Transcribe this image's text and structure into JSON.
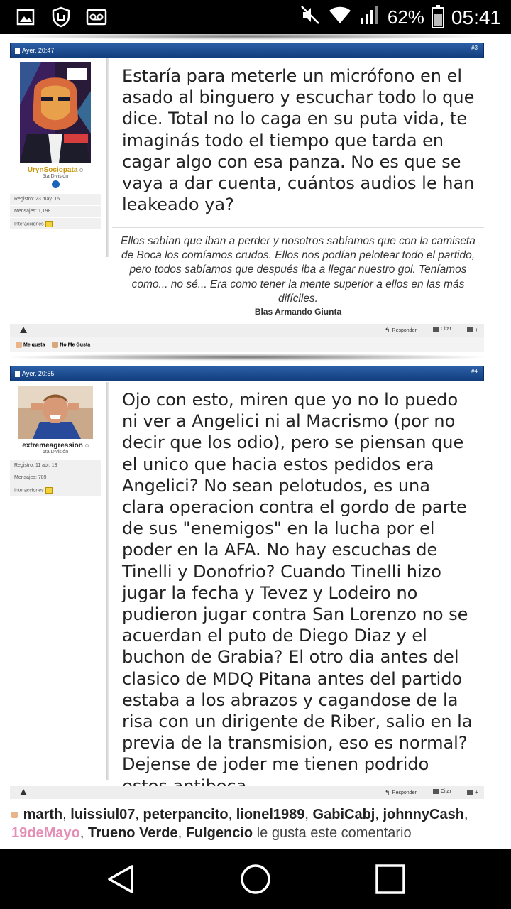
{
  "status_bar": {
    "battery": "62%",
    "time": "05:41",
    "icons": [
      "image-icon",
      "shield-hand-icon",
      "voicemail-icon",
      "mute-icon",
      "wifi-icon",
      "signal-icon",
      "battery-icon"
    ]
  },
  "posts": [
    {
      "date": "Ayer, 20:47",
      "number": "#3",
      "user": {
        "name": "UrynSociopata",
        "rank": "5ta División",
        "registro": "Registro: 23 may. 15",
        "mensajes": "Mensajes: 1,198",
        "interacciones": "Interacciones"
      },
      "text": "Estaría para meterle un micrófono en el asado al binguero y escuchar todo lo que dice. Total no lo caga en su puta vida, te imaginás todo el tiempo que tarda en cagar algo con esa panza. No es que se vaya a dar cuenta, cuántos audios le han leakeado ya?",
      "signature": {
        "quote": "Ellos sabían que iban a perder y nosotros sabíamos que con la camiseta de Boca los comíamos crudos. Ellos nos podían pelotear todo el partido, pero todos sabíamos que después iba a llegar nuestro gol. Teníamos como... no sé... Era como tener la mente superior a ellos en las más difíciles.",
        "author": "Blas Armando Giunta"
      },
      "actions": {
        "reply": "Responder",
        "quote": "Citar"
      },
      "likes": {
        "like": "Me gusta",
        "dislike": "No Me Gusta"
      }
    },
    {
      "date": "Ayer, 20:55",
      "number": "#4",
      "user": {
        "name": "extremeagression",
        "rank": "6ta División",
        "registro": "Registro: 11 abr. 13",
        "mensajes": "Mensajes: 789",
        "interacciones": "Interacciones"
      },
      "text": "Ojo con esto, miren que yo no lo puedo ni ver a Angelici ni al Macrismo (por no decir que los odio), pero se piensan que el unico que hacia estos pedidos era Angelici? No sean pelotudos, es una clara operacion contra el gordo de parte de sus \"enemigos\" en la lucha por el poder en la AFA. No hay escuchas de Tinelli y Donofrio? Cuando Tinelli hizo jugar la fecha y Tevez y Lodeiro no pudieron jugar contra San Lorenzo no se acuerdan el puto de Diego Diaz y el buchon de Grabia? El otro dia antes del clasico de MDQ Pitana antes del partido estaba a los abrazos y cagandose de la risa con un dirigente de Riber, salio en la previa de la transmision, eso es normal? Dejense de joder me tienen podrido estos antiboca...",
      "actions": {
        "reply": "Responder",
        "quote": "Citar"
      }
    }
  ],
  "likers": {
    "names": [
      "marth",
      "luissiul07",
      "peterpancito",
      "lionel1989",
      "GabiCabj",
      "johnnyCash",
      "19deMayo",
      "Trueno Verde",
      "Fulgencio"
    ],
    "suffix": "le gusta este comentario"
  },
  "colors": {
    "header_blue": "#1f4f92",
    "pink_name": "#e58fb6",
    "username_gold": "#c8960c"
  }
}
